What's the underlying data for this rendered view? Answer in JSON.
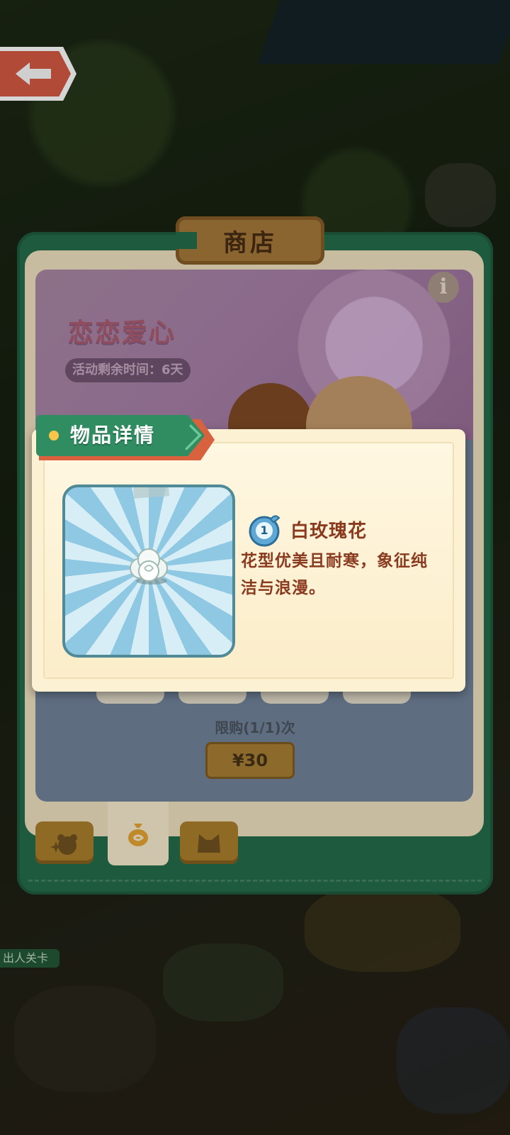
{
  "shop": {
    "title": "商店",
    "banner_title": "恋恋爱心",
    "timer_text": "活动剩余时间：6天",
    "info_label": "i",
    "limit_text": "限购(1/1)次",
    "price": "¥30",
    "tabs": [
      {
        "icon": "bear-sparkle-icon",
        "active": false
      },
      {
        "icon": "money-bag-icon",
        "active": true
      },
      {
        "icon": "cat-face-icon",
        "active": false
      }
    ]
  },
  "world": {
    "label": "出人关卡"
  },
  "popup": {
    "ribbon_label": "物品详情",
    "item": {
      "level": "1",
      "name": "白玫瑰花",
      "description": "花型优美且耐寒，象征纯洁与浪漫。",
      "icon": "white-rose-icon"
    }
  },
  "colors": {
    "ribbon_green": "#2f8d61",
    "ribbon_orange": "#d9623e",
    "text_brown": "#8a3a1e",
    "card_blue": "#8fc8e3"
  }
}
